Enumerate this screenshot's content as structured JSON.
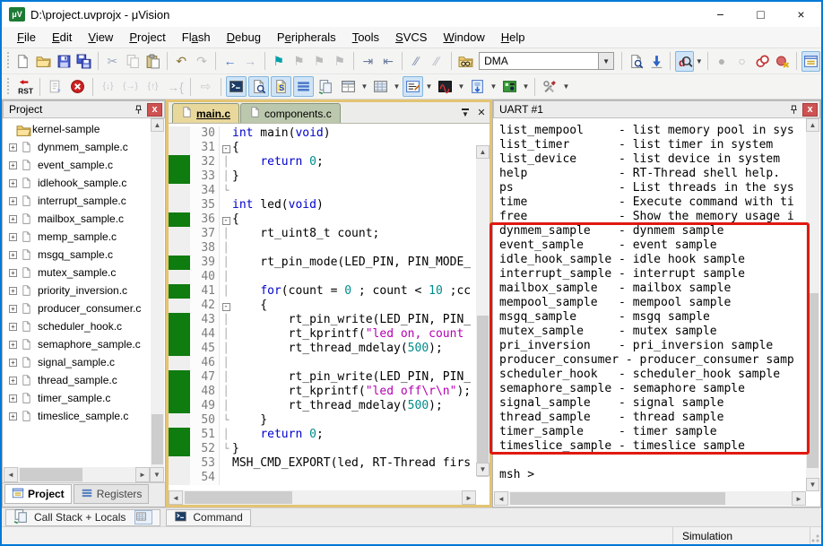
{
  "window": {
    "title": "D:\\project.uvprojx - μVision",
    "minimize": "−",
    "maximize": "□",
    "close": "×"
  },
  "menu": {
    "items": [
      {
        "label": "File",
        "u": 0
      },
      {
        "label": "Edit",
        "u": 0
      },
      {
        "label": "View",
        "u": 0
      },
      {
        "label": "Project",
        "u": 0
      },
      {
        "label": "Flash",
        "u": 2
      },
      {
        "label": "Debug",
        "u": 0
      },
      {
        "label": "Peripherals",
        "u": 1
      },
      {
        "label": "Tools",
        "u": 0
      },
      {
        "label": "SVCS",
        "u": 0
      },
      {
        "label": "Window",
        "u": 0
      },
      {
        "label": "Help",
        "u": 0
      }
    ]
  },
  "toolbar1": {
    "dma_value": "DMA",
    "groups": [
      [
        {
          "n": "new-file",
          "i": "page"
        },
        {
          "n": "open-file",
          "i": "folder"
        },
        {
          "n": "save",
          "i": "floppy"
        },
        {
          "n": "save-all",
          "i": "floppy2"
        }
      ],
      [
        {
          "n": "cut",
          "g": "✂",
          "c": "#a0aabc"
        },
        {
          "n": "copy",
          "i": "copy",
          "d": true
        },
        {
          "n": "paste",
          "i": "paste"
        }
      ],
      [
        {
          "n": "undo",
          "g": "↶",
          "c": "#8a7430"
        },
        {
          "n": "redo",
          "g": "↷",
          "c": "#bcbcbc"
        }
      ],
      [
        {
          "n": "navigate-back",
          "g": "←",
          "c": "#3c6cc8"
        },
        {
          "n": "navigate-forward",
          "g": "→",
          "c": "#b4bcc4"
        }
      ],
      [
        {
          "n": "toggle-bookmark",
          "g": "⚑",
          "c": "#00a0a8"
        },
        {
          "n": "previous-bookmark",
          "g": "⚑",
          "c": "#bcbcbc"
        },
        {
          "n": "next-bookmark",
          "g": "⚑",
          "c": "#bcbcbc"
        },
        {
          "n": "clear-bookmarks",
          "g": "⚑",
          "c": "#bcbcbc"
        }
      ],
      [
        {
          "n": "indent",
          "g": "⇥",
          "c": "#6a7a9a"
        },
        {
          "n": "outdent",
          "g": "⇤",
          "c": "#6a7a9a"
        }
      ],
      [
        {
          "n": "comment",
          "g": "∕∕",
          "c": "#7a8aa8"
        },
        {
          "n": "uncomment",
          "g": "∕∕",
          "c": "#b4b4c0"
        }
      ],
      [
        {
          "n": "find-in-files",
          "i": "findfolder"
        },
        {
          "combo": true
        }
      ],
      [
        {
          "n": "lookup",
          "i": "lookup"
        },
        {
          "n": "load-application",
          "i": "loadapp"
        }
      ],
      [
        {
          "n": "start-stop-debug",
          "i": "dmag",
          "hl": true,
          "caret": true
        }
      ],
      [
        {
          "n": "insert-breakpoint",
          "g": "●",
          "c": "#b4b4b4"
        },
        {
          "n": "enable-breakpoint",
          "g": "○",
          "c": "#b4b4b4"
        },
        {
          "n": "disable-all-breakpoints",
          "i": "bp2"
        },
        {
          "n": "kill-all-breakpoints",
          "i": "bpx"
        }
      ],
      [
        {
          "n": "project-window",
          "i": "projwin",
          "hl": true
        }
      ]
    ]
  },
  "toolbar2": {
    "groups": [
      [
        {
          "n": "reset",
          "i": "rst"
        }
      ],
      [
        {
          "n": "insert-trace",
          "i": "stepdoc",
          "d": true
        },
        {
          "n": "stop",
          "i": "stop"
        }
      ],
      [
        {
          "n": "step",
          "g": "{↓}",
          "c": "#9aa4ae",
          "d": true
        },
        {
          "n": "step-over",
          "g": "{→}",
          "c": "#9aa4ae",
          "d": true
        },
        {
          "n": "step-out",
          "g": "{↑}",
          "c": "#9aa4ae",
          "d": true
        },
        {
          "n": "run-to-line",
          "g": "→{",
          "c": "#9aa4ae",
          "d": true
        }
      ],
      [
        {
          "n": "go",
          "g": "⇨",
          "c": "#a8b0a8",
          "d": true
        }
      ],
      [
        {
          "n": "command-window",
          "i": "console",
          "hl": true
        },
        {
          "n": "disassembly-window",
          "i": "lookup",
          "hl": true
        },
        {
          "n": "symbol-window",
          "i": "symbols",
          "hl": true
        },
        {
          "n": "registers-window",
          "i": "regs",
          "hl": true
        },
        {
          "n": "call-stack-window",
          "i": "docs"
        },
        {
          "n": "watch-window",
          "i": "watch",
          "caret": true
        },
        {
          "n": "memory-window",
          "i": "memory",
          "caret": true
        },
        {
          "n": "serial-window",
          "i": "serial",
          "hl": true,
          "caret": true
        },
        {
          "n": "logic-analyzer",
          "i": "analyzer",
          "caret": true
        },
        {
          "n": "system-viewer",
          "i": "sysview",
          "caret": true
        },
        {
          "n": "toolbox",
          "i": "toolbox",
          "caret": true
        }
      ],
      [
        {
          "n": "configure-tools",
          "i": "tools",
          "caret": true
        }
      ]
    ]
  },
  "project": {
    "header": "Project",
    "root": "kernel-sample",
    "files": [
      "dynmem_sample.c",
      "event_sample.c",
      "idlehook_sample.c",
      "interrupt_sample.c",
      "mailbox_sample.c",
      "memp_sample.c",
      "msgq_sample.c",
      "mutex_sample.c",
      "priority_inversion.c",
      "producer_consumer.c",
      "scheduler_hook.c",
      "semaphore_sample.c",
      "signal_sample.c",
      "thread_sample.c",
      "timer_sample.c",
      "timeslice_sample.c"
    ],
    "tabs": [
      {
        "label": "Project",
        "active": true
      },
      {
        "label": "Registers",
        "active": false
      }
    ]
  },
  "editor": {
    "tabs": [
      {
        "label": "main.c",
        "active": true
      },
      {
        "label": "components.c",
        "active": false
      }
    ],
    "lines": [
      {
        "n": 30,
        "cov": false,
        "f": "",
        "segs": [
          [
            "k",
            "int"
          ],
          [
            "p",
            " main("
          ],
          [
            "k",
            "void"
          ],
          [
            "p",
            ")"
          ]
        ]
      },
      {
        "n": 31,
        "cov": false,
        "f": "b",
        "segs": [
          [
            "p",
            "{"
          ]
        ]
      },
      {
        "n": 32,
        "cov": true,
        "f": "p",
        "segs": [
          [
            "p",
            "    "
          ],
          [
            "k",
            "return"
          ],
          [
            "p",
            " "
          ],
          [
            "n",
            "0"
          ],
          [
            "p",
            ";"
          ]
        ]
      },
      {
        "n": 33,
        "cov": true,
        "f": "p",
        "segs": [
          [
            "p",
            "}"
          ]
        ]
      },
      {
        "n": 34,
        "cov": false,
        "f": "e",
        "segs": []
      },
      {
        "n": 35,
        "cov": false,
        "f": "",
        "segs": [
          [
            "k",
            "int"
          ],
          [
            "p",
            " led("
          ],
          [
            "k",
            "void"
          ],
          [
            "p",
            ")"
          ]
        ]
      },
      {
        "n": 36,
        "cov": true,
        "f": "b",
        "segs": [
          [
            "p",
            "{"
          ]
        ]
      },
      {
        "n": 37,
        "cov": false,
        "f": "p",
        "segs": [
          [
            "p",
            "    rt_uint8_t count;"
          ]
        ]
      },
      {
        "n": 38,
        "cov": false,
        "f": "p",
        "segs": []
      },
      {
        "n": 39,
        "cov": true,
        "f": "p",
        "segs": [
          [
            "p",
            "    rt_pin_mode(LED_PIN, PIN_MODE_"
          ]
        ]
      },
      {
        "n": 40,
        "cov": false,
        "f": "p",
        "segs": []
      },
      {
        "n": 41,
        "cov": true,
        "f": "p",
        "segs": [
          [
            "p",
            "    "
          ],
          [
            "k",
            "for"
          ],
          [
            "p",
            "(count = "
          ],
          [
            "n",
            "0"
          ],
          [
            "p",
            " ; count < "
          ],
          [
            "n",
            "10"
          ],
          [
            "p",
            " ;cc"
          ]
        ]
      },
      {
        "n": 42,
        "cov": false,
        "f": "b",
        "segs": [
          [
            "p",
            "    {"
          ]
        ]
      },
      {
        "n": 43,
        "cov": true,
        "f": "p",
        "segs": [
          [
            "p",
            "        rt_pin_write(LED_PIN, PIN_"
          ]
        ]
      },
      {
        "n": 44,
        "cov": true,
        "f": "p",
        "segs": [
          [
            "p",
            "        rt_kprintf("
          ],
          [
            "s",
            "\"led on, count"
          ]
        ]
      },
      {
        "n": 45,
        "cov": true,
        "f": "p",
        "segs": [
          [
            "p",
            "        rt_thread_mdelay("
          ],
          [
            "n",
            "500"
          ],
          [
            "p",
            ");"
          ]
        ]
      },
      {
        "n": 46,
        "cov": false,
        "f": "p",
        "segs": []
      },
      {
        "n": 47,
        "cov": true,
        "f": "p",
        "segs": [
          [
            "p",
            "        rt_pin_write(LED_PIN, PIN_"
          ]
        ]
      },
      {
        "n": 48,
        "cov": true,
        "f": "p",
        "segs": [
          [
            "p",
            "        rt_kprintf("
          ],
          [
            "s",
            "\"led off\\r\\n\""
          ],
          [
            "p",
            ");"
          ]
        ]
      },
      {
        "n": 49,
        "cov": true,
        "f": "p",
        "segs": [
          [
            "p",
            "        rt_thread_mdelay("
          ],
          [
            "n",
            "500"
          ],
          [
            "p",
            ");"
          ]
        ]
      },
      {
        "n": 50,
        "cov": false,
        "f": "e",
        "segs": [
          [
            "p",
            "    }"
          ]
        ]
      },
      {
        "n": 51,
        "cov": true,
        "f": "p",
        "segs": [
          [
            "p",
            "    "
          ],
          [
            "k",
            "return"
          ],
          [
            "p",
            " "
          ],
          [
            "n",
            "0"
          ],
          [
            "p",
            ";"
          ]
        ]
      },
      {
        "n": 52,
        "cov": true,
        "f": "e",
        "segs": [
          [
            "p",
            "}"
          ]
        ]
      },
      {
        "n": 53,
        "cov": false,
        "f": "",
        "segs": [
          [
            "p",
            "MSH_CMD_EXPORT(led, RT-Thread firs"
          ]
        ]
      },
      {
        "n": 54,
        "cov": false,
        "f": "",
        "segs": []
      }
    ]
  },
  "uart": {
    "header": "UART #1",
    "lines": [
      "list_mempool     - list memory pool in sys",
      "list_timer       - list timer in system",
      "list_device      - list device in system",
      "help             - RT-Thread shell help.",
      "ps               - List threads in the sys",
      "time             - Execute command with ti",
      "free             - Show the memory usage i",
      "dynmem_sample    - dynmem sample",
      "event_sample     - event sample",
      "idle_hook_sample - idle hook sample",
      "interrupt_sample - interrupt sample",
      "mailbox_sample   - mailbox sample",
      "mempool_sample   - mempool sample",
      "msgq_sample      - msgq sample",
      "mutex_sample     - mutex sample",
      "pri_inversion    - pri_inversion sample",
      "producer_consumer - producer_consumer samp",
      "scheduler_hook   - scheduler_hook sample",
      "semaphore_sample - semaphore sample",
      "signal_sample    - signal sample",
      "thread_sample    - thread sample",
      "timer_sample     - timer sample",
      "timeslice_sample - timeslice sample",
      "",
      "msh >"
    ]
  },
  "bottom": {
    "callstack_tab": "Call Stack + Locals",
    "command_tab": "Command"
  },
  "status": {
    "mode": "Simulation"
  }
}
